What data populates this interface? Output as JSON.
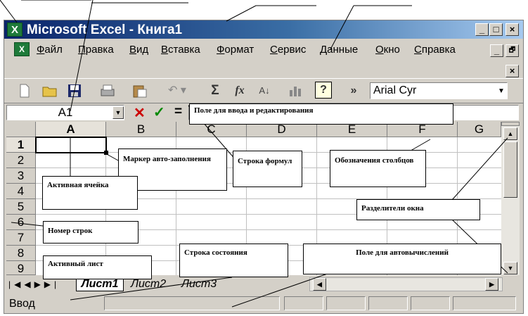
{
  "window": {
    "title": "Microsoft Excel - Книга1",
    "app_icon": "excel-icon",
    "caption_buttons": [
      "_",
      "□",
      "×"
    ]
  },
  "menu": {
    "items": [
      "Файл",
      "Правка",
      "Вид",
      "Вставка",
      "Формат",
      "Сервис",
      "Данные",
      "Окно",
      "Справка"
    ],
    "doc_buttons": [
      "_",
      "🗗",
      "×"
    ]
  },
  "toolbar": {
    "icons": [
      "new-icon",
      "open-icon",
      "save-icon",
      "print-icon",
      "paste-icon",
      "undo-icon",
      "sum-icon",
      "function-icon",
      "sort-icon",
      "chart-icon",
      "help-icon"
    ],
    "sum_label": "Σ",
    "fx_label": "fx",
    "help_label": "?",
    "more_label": "»",
    "font_name": "Arial Cyr"
  },
  "formula_bar": {
    "name_box": "A1",
    "cancel": "✕",
    "enter": "✓",
    "equals": "="
  },
  "grid": {
    "columns": [
      "A",
      "B",
      "C",
      "D",
      "E",
      "F",
      "G"
    ],
    "rows": [
      "1",
      "2",
      "3",
      "4",
      "5",
      "6",
      "7",
      "8",
      "9"
    ],
    "active_cell": "A1"
  },
  "sheets": {
    "tabs": [
      "Лист1",
      "Лист2",
      "Лист3"
    ],
    "active": "Лист1"
  },
  "status": {
    "mode": "Ввод"
  },
  "callouts": {
    "formula_edit_field": "Поле для ввода и редактирования",
    "autofill_marker": "Маркер авто-заполнения",
    "formula_bar": "Строка формул",
    "column_headers": "Обозначения столбцов",
    "active_cell": "Активная ячейка",
    "window_splitters": "Разделители окна",
    "row_number": "Номер строк",
    "active_sheet": "Активный лист",
    "status_bar": "Строка состояния",
    "autocalc_field": "Поле для автовычислений"
  }
}
